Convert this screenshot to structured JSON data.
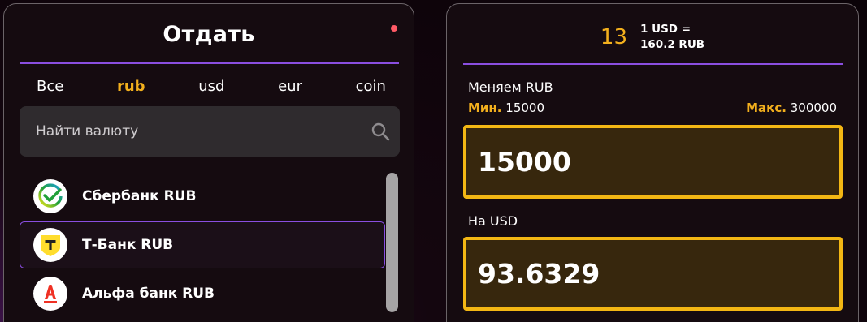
{
  "give_panel": {
    "title": "Отдать",
    "tabs": [
      {
        "label": "Все",
        "active": false
      },
      {
        "label": "rub",
        "active": true
      },
      {
        "label": "usd",
        "active": false
      },
      {
        "label": "eur",
        "active": false
      },
      {
        "label": "coin",
        "active": false
      }
    ],
    "search": {
      "placeholder": "Найти валюту",
      "value": ""
    },
    "items": [
      {
        "label": "Сбербанк RUB",
        "icon": "sberbank-icon",
        "selected": false
      },
      {
        "label": "Т-Банк RUB",
        "icon": "tbank-icon",
        "selected": true
      },
      {
        "label": "Альфа банк RUB",
        "icon": "alfabank-icon",
        "selected": false
      }
    ]
  },
  "exchange_panel": {
    "rate": {
      "timer": "13",
      "line1": "1 USD =",
      "line2": "160.2 RUB"
    },
    "give": {
      "label": "Меняем RUB",
      "min_label": "Мин.",
      "min_value": "15000",
      "max_label": "Макс.",
      "max_value": "300000",
      "amount": "15000"
    },
    "receive": {
      "label": "На USD",
      "amount": "93.6329"
    }
  },
  "colors": {
    "accent": "#f3b01d",
    "divider": "#8a4ee0",
    "notification": "#ff5a66"
  }
}
